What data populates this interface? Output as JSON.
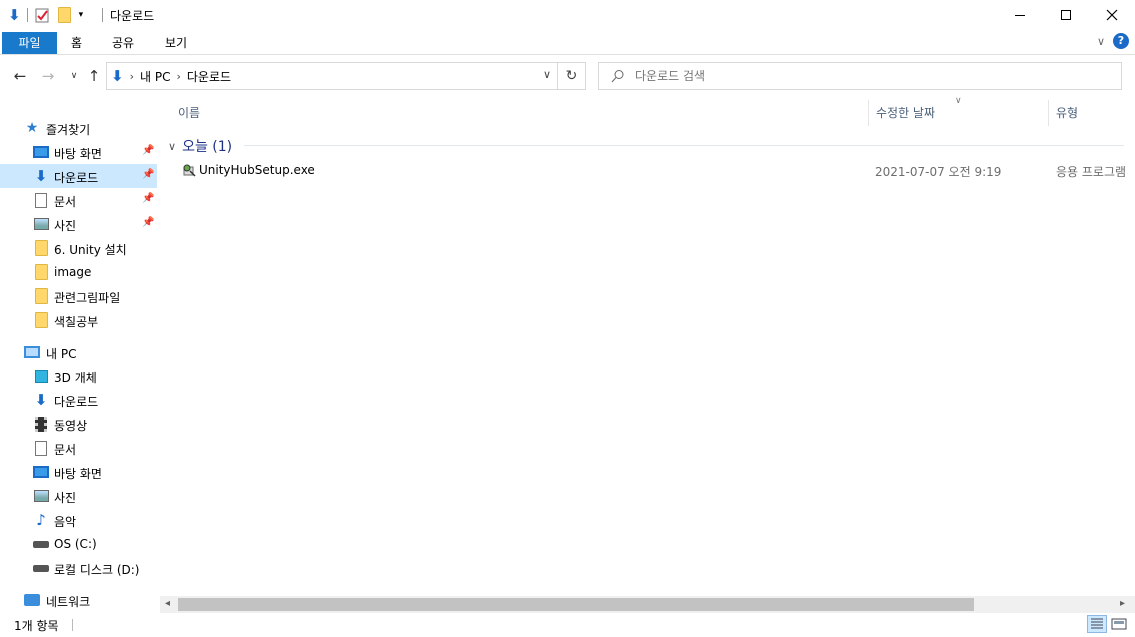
{
  "window": {
    "title": "다운로드"
  },
  "ribbon": {
    "tabs": [
      "파일",
      "홈",
      "공유",
      "보기"
    ]
  },
  "address": {
    "crumbs": [
      "내 PC",
      "다운로드"
    ]
  },
  "search": {
    "placeholder": "다운로드 검색"
  },
  "nav": {
    "quick_access": {
      "label": "즐겨찾기",
      "items": [
        {
          "label": "바탕 화면",
          "icon": "desktop-icon",
          "pinned": true
        },
        {
          "label": "다운로드",
          "icon": "download-icon",
          "pinned": true,
          "selected": true
        },
        {
          "label": "문서",
          "icon": "document-icon",
          "pinned": true
        },
        {
          "label": "사진",
          "icon": "picture-icon",
          "pinned": true
        },
        {
          "label": "6. Unity 설치",
          "icon": "folder-icon"
        },
        {
          "label": "image",
          "icon": "folder-icon"
        },
        {
          "label": "관련그림파일",
          "icon": "folder-icon"
        },
        {
          "label": "색칠공부",
          "icon": "folder-icon"
        }
      ]
    },
    "this_pc": {
      "label": "내 PC",
      "items": [
        {
          "label": "3D 개체",
          "icon": "3d-objects-icon"
        },
        {
          "label": "다운로드",
          "icon": "download-icon"
        },
        {
          "label": "동영상",
          "icon": "video-icon"
        },
        {
          "label": "문서",
          "icon": "document-icon"
        },
        {
          "label": "바탕 화면",
          "icon": "desktop-icon"
        },
        {
          "label": "사진",
          "icon": "picture-icon"
        },
        {
          "label": "음악",
          "icon": "music-icon"
        },
        {
          "label": "OS (C:)",
          "icon": "drive-icon"
        },
        {
          "label": "로컬 디스크 (D:)",
          "icon": "drive-icon"
        }
      ]
    },
    "network": {
      "label": "네트워크"
    }
  },
  "columns": {
    "name": "이름",
    "date": "수정한 날짜",
    "type": "유형"
  },
  "group": {
    "label": "오늘 (1)"
  },
  "files": [
    {
      "name": "UnityHubSetup.exe",
      "date": "2021-07-07 오전 9:19",
      "type": "응용 프로그램"
    }
  ],
  "status": {
    "count": "1개 항목"
  },
  "colors": {
    "accent": "#1979ca",
    "selection": "#cce8ff",
    "group_text": "#1e3287"
  }
}
